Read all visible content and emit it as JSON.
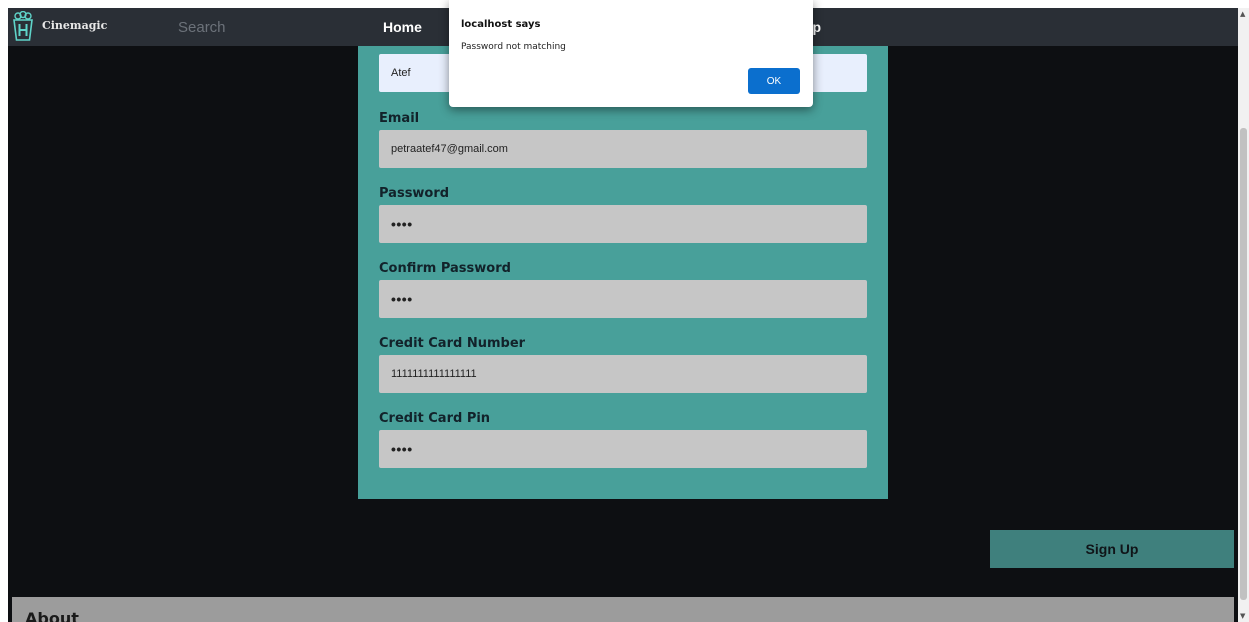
{
  "navbar": {
    "brand": "Cinemagic",
    "search_placeholder": "Search",
    "home": "Home",
    "signup": "Sign Up",
    "signup_visible": "up"
  },
  "form": {
    "name_value": "Atef",
    "email_label": "Email",
    "email_value": "petraatef47@gmail.com",
    "password_label": "Password",
    "password_value": "••••",
    "confirm_label": "Confirm Password",
    "confirm_value": "••••",
    "cc_label": "Credit Card Number",
    "cc_value": "1111111111111111",
    "pin_label": "Credit Card Pin",
    "pin_value": "••••"
  },
  "signup_button": "Sign Up",
  "about": {
    "title": "About"
  },
  "alert": {
    "title": "localhost says",
    "message": "Password not matching",
    "ok": "OK"
  },
  "colors": {
    "page_bg": "#0d0f12",
    "navbar_bg": "#2a2f36",
    "form_bg": "#48a09a",
    "input_bg": "#c6c6c6",
    "button_bg": "#3f807d",
    "ok_button": "#0b6fce"
  },
  "icons": {
    "logo": "popcorn-bucket-logo-icon"
  }
}
